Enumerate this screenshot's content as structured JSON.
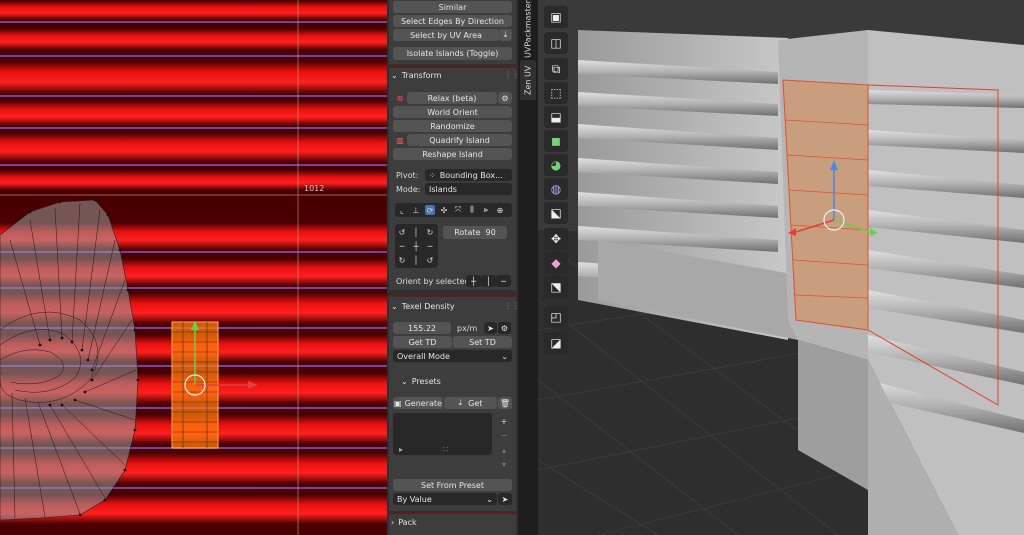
{
  "uv_editor": {
    "grid_label": "1012"
  },
  "panel": {
    "top_buttons": [
      "Similar",
      "Select Edges By Direction",
      "Select by UV Area",
      "Isolate Islands (Toggle)"
    ],
    "transform": {
      "title": "Transform",
      "buttons": [
        "Relax (beta)",
        "World Orient",
        "Randomize",
        "Quadrify Island",
        "Reshape Island"
      ],
      "pivot_label": "Pivot:",
      "pivot_value": "Bounding Box...",
      "mode_label": "Mode:",
      "mode_value": "Islands",
      "rotate_label": "Rotate",
      "rotate_value": "90",
      "orient_label": "Orient by selected"
    },
    "texel_density": {
      "title": "Texel Density",
      "value": "155.22",
      "unit": "px/m",
      "get_td": "Get TD",
      "set_td": "Set TD",
      "mode": "Overall Mode",
      "presets_title": "Presets",
      "generate": "Generate",
      "get": "Get",
      "set_from_preset": "Set From Preset",
      "by_value": "By Value"
    },
    "pack": {
      "title": "Pack"
    }
  },
  "tabs": [
    "UVPackmaster",
    "Zen UV"
  ],
  "colors": {
    "accent": "#4772b3",
    "selection": "#ff8a1f",
    "panel_divider": "#7a1010"
  }
}
